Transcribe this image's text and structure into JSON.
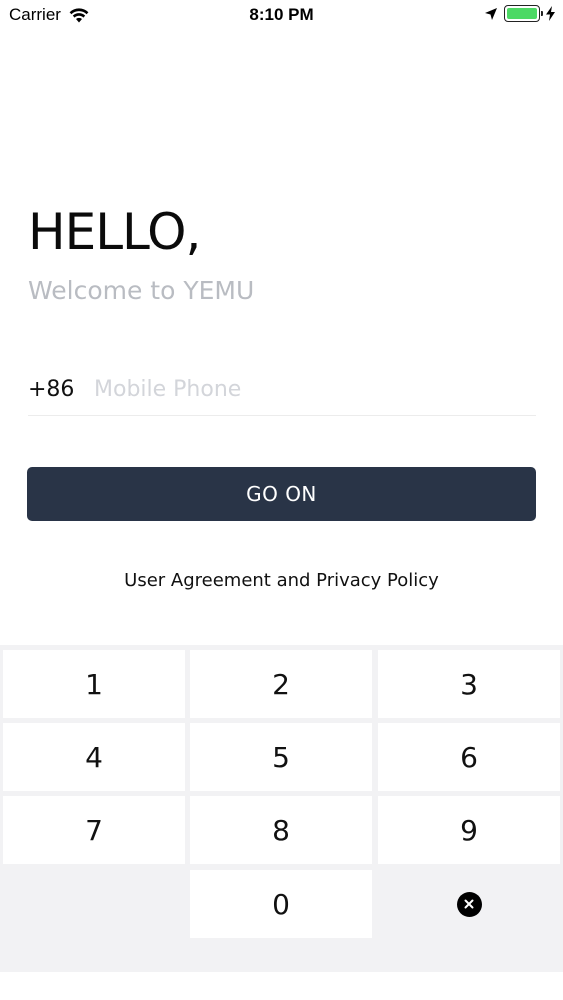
{
  "status_bar": {
    "carrier": "Carrier",
    "time": "8:10 PM",
    "icons": [
      "wifi-icon",
      "location-arrow-icon",
      "battery-icon",
      "charging-bolt-icon"
    ],
    "battery_color": "#4cd964"
  },
  "header": {
    "greeting": "HELLO,",
    "subtitle": "Welcome to YEMU"
  },
  "login": {
    "country_code": "+86",
    "phone_placeholder": "Mobile Phone",
    "phone_value": "",
    "go_button_label": "GO ON",
    "agreement_link": "User Agreement and Privacy Policy"
  },
  "keypad": {
    "keys": [
      "1",
      "2",
      "3",
      "4",
      "5",
      "6",
      "7",
      "8",
      "9",
      "0"
    ],
    "delete_icon": "delete-circle-x-icon"
  },
  "colors": {
    "button_bg": "#293447",
    "subtitle": "#b9bcc2",
    "placeholder": "#d3d5da",
    "keypad_bg": "#f2f2f4"
  }
}
